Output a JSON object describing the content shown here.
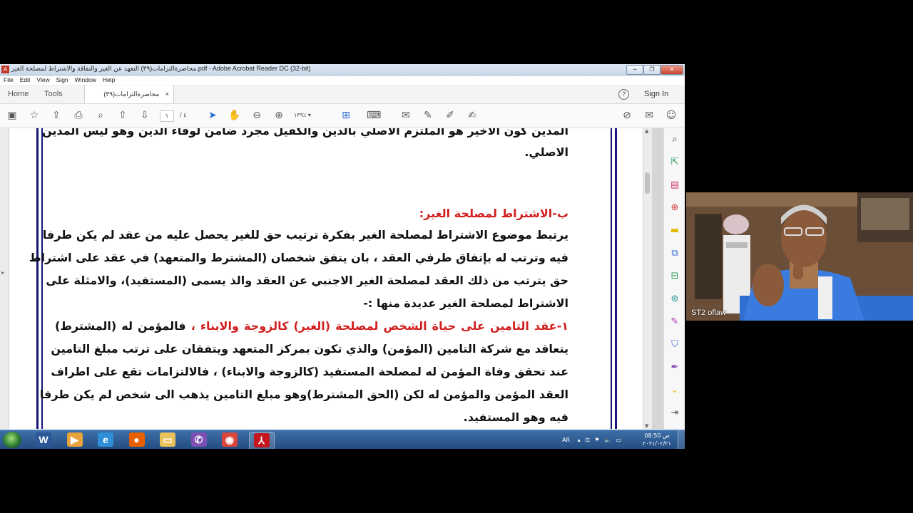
{
  "window": {
    "title": "محاضرةالتزامات(٣٩) التعهد عن الغير والنفاقة والاشتراط لمصلحة الغير.pdf - Adobe Acrobat Reader DC (32-bit)",
    "app_icon": "A",
    "minimize": "─",
    "restore": "❐",
    "close": "✕"
  },
  "menu": [
    "File",
    "Edit",
    "View",
    "Sign",
    "Window",
    "Help"
  ],
  "tabs": {
    "home": "Home",
    "tools": "Tools",
    "document": "محاضرةالتزامات(٣٩) التع...",
    "document_close": "×"
  },
  "header": {
    "help": "?",
    "sign_in": "Sign In"
  },
  "toolbar": {
    "page_current": "١",
    "page_total": "/ ٤",
    "zoom": "١٣٩٪ ▾",
    "icons": [
      "save-icon",
      "bookmark-star-icon",
      "upload-icon",
      "print-icon",
      "search-icon",
      "page-up-icon",
      "page-down-icon",
      "select-cursor-icon",
      "hand-icon",
      "zoom-out-icon",
      "zoom-in-icon",
      "fit-page-icon",
      "scroll-mode-icon",
      "comment-icon",
      "highlight-icon",
      "draw-icon",
      "sign-icon",
      "share-link-icon",
      "email-icon",
      "add-person-icon"
    ]
  },
  "document": {
    "lines": [
      {
        "text": "المدين كون الأخير هو الملتزم الأصلي بالدين والكفيل مجرد ضامن لوفاء الدين وهو ليس المدين",
        "red": ""
      },
      {
        "text": "الاصلي.",
        "red": "",
        "short": true
      },
      {
        "text": "",
        "red": "ب-الاشتراط لمصلحة الغير:",
        "short": true
      },
      {
        "text": "يرتبط موضوع الاشتراط لمصلحة الغير بفكرة ترتيب حق للغير يحصل عليه من عقد لم يكن طرفا",
        "red": ""
      },
      {
        "text": "فيه وترتب له بإتفاق طرفي العقد ، بان يتفق شخصان (المشترط والمتعهد) في عقد على اشتراط",
        "red": ""
      },
      {
        "text": "حق يترتب من ذلك العقد لمصلحة الغير الاجنبي عن العقد والذ يسمى (المستفيد)، والامثلة على",
        "red": ""
      },
      {
        "text": "الاشتراط لمصلحة الغير عديدة منها :-",
        "red": "",
        "short": true
      },
      {
        "text": "فالمؤمن له (المشترط)",
        "red": "١-عقد التامين على حياة الشخص لمصلحة (الغير) كالزوجة والابناء ،"
      },
      {
        "text": "يتعاقد مع شركة التامين (المؤمن) والذي تكون بمركز المتعهد ويتفقان على ترتب مبلغ التامين",
        "red": ""
      },
      {
        "text": "عند تحقق وفاة المؤمن له لمصلحة المستفيد (كالزوجة والابناء) ، فالالتزامات تقع على اطراف",
        "red": ""
      },
      {
        "text": "العقد المؤمن والمؤمن له لكن (الحق المشترط)وهو مبلغ التامين يذهب الى شخص لم يكن طرفا",
        "red": ""
      },
      {
        "text": "فيه وهو المستفيد.",
        "red": "",
        "short": true
      }
    ]
  },
  "right_panel_icons": [
    "search-icon",
    "export-pdf-icon",
    "organize-pages-icon",
    "create-pdf-icon",
    "comment-icon",
    "combine-files-icon",
    "edit-pdf-icon",
    "send-review-icon",
    "fill-sign-icon",
    "protect-icon",
    "sign-pen-icon",
    "more-tools-icon",
    "expand-icon"
  ],
  "taskbar": {
    "apps": [
      {
        "name": "word",
        "label": "W",
        "color": "#2b5797"
      },
      {
        "name": "media-player",
        "label": "▶",
        "color": "#e8a33d"
      },
      {
        "name": "internet-explorer",
        "label": "e",
        "color": "#2e8fd6"
      },
      {
        "name": "firefox",
        "label": "●",
        "color": "#e66000"
      },
      {
        "name": "file-explorer",
        "label": "▭",
        "color": "#e8c15a"
      },
      {
        "name": "viber",
        "label": "✆",
        "color": "#7d4fb3"
      },
      {
        "name": "chrome",
        "label": "◉",
        "color": "#d9463b"
      },
      {
        "name": "acrobat",
        "label": "⅄",
        "color": "#c4161c"
      }
    ],
    "lang": "AR",
    "time": "08:50 ص",
    "date": "٢٠٢١/٠٢/٢١"
  },
  "video": {
    "participant": "ST2 oflaw"
  },
  "colors": {
    "heading_red": "#d11e1e",
    "frame_blue": "#15157a"
  }
}
